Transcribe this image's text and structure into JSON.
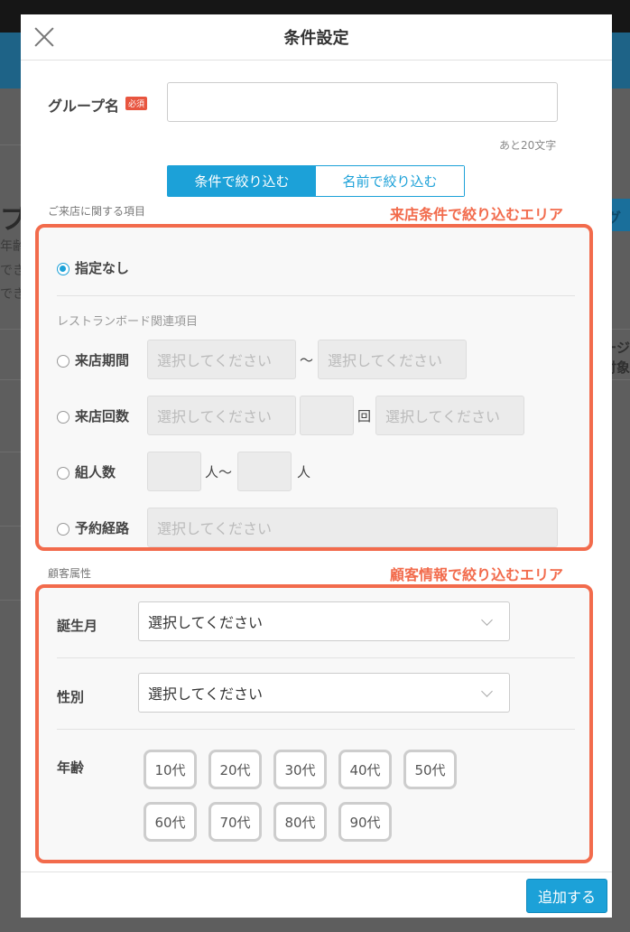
{
  "background": {
    "title_fragment": "プ",
    "side_texts": [
      "年齢",
      "でき",
      "でき"
    ],
    "right_button_text": "グル",
    "right_texts": [
      "ージ",
      "付象"
    ]
  },
  "modal": {
    "title": "条件設定",
    "group_name_label": "グループ名",
    "required_badge": "必須",
    "group_name_value": "",
    "char_count": "あと20文字",
    "tabs": [
      {
        "label": "条件で絞り込む",
        "active": true
      },
      {
        "label": "名前で絞り込む",
        "active": false
      }
    ],
    "visit_section": {
      "label": "ご来店に関する項目",
      "annotation": "来店条件で絞り込むエリア",
      "none_option": "指定なし",
      "subheading": "レストランボード関連項目",
      "rows": {
        "period": {
          "label": "来店期間",
          "placeholder_from": "選択してください",
          "separator": "〜",
          "placeholder_to": "選択してください"
        },
        "count": {
          "label": "来店回数",
          "placeholder_from": "選択してください",
          "unit": "回",
          "placeholder_to": "選択してください"
        },
        "party": {
          "label": "組人数",
          "unit_from": "人〜",
          "unit_to": "人"
        },
        "route": {
          "label": "予約経路",
          "placeholder": "選択してください"
        }
      }
    },
    "customer_section": {
      "label": "顧客属性",
      "annotation": "顧客情報で絞り込むエリア",
      "birth_month": {
        "label": "誕生月",
        "selected": "選択してください"
      },
      "gender": {
        "label": "性別",
        "selected": "選択してください"
      },
      "age": {
        "label": "年齢",
        "options": [
          "10代",
          "20代",
          "30代",
          "40代",
          "50代",
          "60代",
          "70代",
          "80代",
          "90代"
        ]
      }
    },
    "add_button": "追加する"
  },
  "colors": {
    "accent": "#1ca1d8",
    "annotation": "#f26b4c",
    "required": "#e8553f"
  }
}
